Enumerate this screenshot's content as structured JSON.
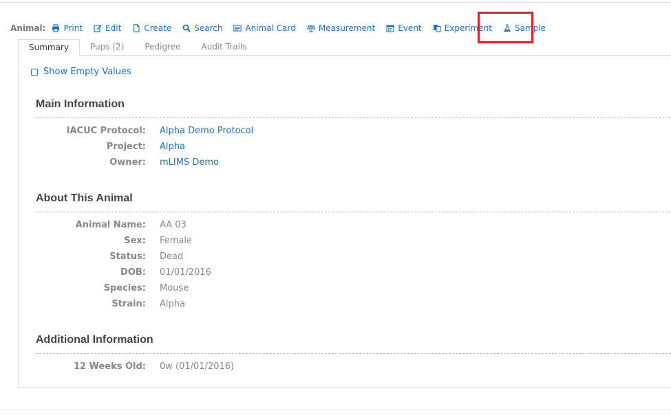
{
  "toolbar": {
    "label": "Animal:",
    "items": [
      {
        "label": "Print",
        "icon": "print-icon"
      },
      {
        "label": "Edit",
        "icon": "edit-icon"
      },
      {
        "label": "Create",
        "icon": "file-icon"
      },
      {
        "label": "Search",
        "icon": "search-icon"
      },
      {
        "label": "Animal Card",
        "icon": "card-icon"
      },
      {
        "label": "Measurement",
        "icon": "balance-scale-icon"
      },
      {
        "label": "Event",
        "icon": "calendar-icon"
      },
      {
        "label": "Experiment",
        "icon": "copy-icon"
      },
      {
        "label": "Sample",
        "icon": "flask-icon"
      }
    ]
  },
  "tabs": [
    {
      "label": "Summary",
      "active": true
    },
    {
      "label": "Pups (2)",
      "active": false
    },
    {
      "label": "Pedigree",
      "active": false
    },
    {
      "label": "Audit Trails",
      "active": false
    }
  ],
  "show_empty": {
    "label": "Show Empty Values"
  },
  "main_information": {
    "title": "Main Information",
    "rows": [
      {
        "label": "IACUC Protocol:",
        "value": "Alpha Demo Protocol"
      },
      {
        "label": "Project:",
        "value": "Alpha"
      },
      {
        "label": "Owner:",
        "value": "mLIMS Demo"
      }
    ]
  },
  "about_animal": {
    "title": "About This Animal",
    "rows": [
      {
        "label": "Animal Name:",
        "value": "AA 03"
      },
      {
        "label": "Sex:",
        "value": "Female"
      },
      {
        "label": "Status:",
        "value": "Dead"
      },
      {
        "label": "DOB:",
        "value": "01/01/2016"
      },
      {
        "label": "Species:",
        "value": "Mouse"
      },
      {
        "label": "Strain:",
        "value": "Alpha"
      }
    ]
  },
  "additional_information": {
    "title": "Additional Information",
    "rows": [
      {
        "label": "12 Weeks Old:",
        "value": "0w (01/01/2016)"
      }
    ]
  },
  "colors": {
    "link": "#1a73c8",
    "highlight": "#e0202b",
    "label": "#888888"
  }
}
